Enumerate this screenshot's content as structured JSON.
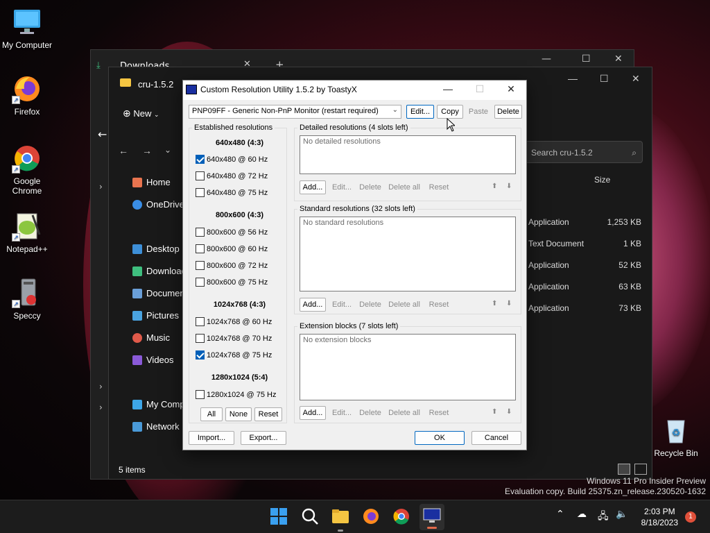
{
  "desktop": {
    "icons": [
      {
        "label": "My Computer"
      },
      {
        "label": "Firefox"
      },
      {
        "label": "Google Chrome"
      },
      {
        "label": "Notepad++"
      },
      {
        "label": "Speccy"
      },
      {
        "label": "Recycle Bin"
      }
    ],
    "watermark_line1": "Windows 11 Pro Insider Preview",
    "watermark_line2": "Evaluation copy. Build 25375.zn_release.230520-1632"
  },
  "explorer_back": {
    "tab_title": "Downloads"
  },
  "explorer": {
    "tab_title": "cru-1.5.2",
    "new_label": "New",
    "search_placeholder": "Search cru-1.5.2",
    "col_size": "Size",
    "nav": [
      "Home",
      "OneDrive",
      "Desktop",
      "Downloads",
      "Documents",
      "Pictures",
      "Music",
      "Videos",
      "My Computer",
      "Network"
    ],
    "rows": [
      {
        "type": "Application",
        "size": "1,253 KB"
      },
      {
        "type": "Text Document",
        "size": "1 KB"
      },
      {
        "type": "Application",
        "size": "52 KB"
      },
      {
        "type": "Application",
        "size": "63 KB"
      },
      {
        "type": "Application",
        "size": "73 KB"
      }
    ],
    "status": "5 items"
  },
  "dialog": {
    "title": "Custom Resolution Utility 1.5.2 by ToastyX",
    "monitor": "PNP09FF - Generic Non-PnP Monitor (restart required)",
    "top_buttons": {
      "edit": "Edit...",
      "copy": "Copy",
      "paste": "Paste",
      "delete": "Delete"
    },
    "established": {
      "title": "Established resolutions",
      "groups": [
        {
          "head": "640x480 (4:3)",
          "items": [
            {
              "label": "640x480 @ 60 Hz",
              "checked": true
            },
            {
              "label": "640x480 @ 72 Hz",
              "checked": false
            },
            {
              "label": "640x480 @ 75 Hz",
              "checked": false
            }
          ]
        },
        {
          "head": "800x600 (4:3)",
          "items": [
            {
              "label": "800x600 @ 56 Hz",
              "checked": false
            },
            {
              "label": "800x600 @ 60 Hz",
              "checked": false
            },
            {
              "label": "800x600 @ 72 Hz",
              "checked": false
            },
            {
              "label": "800x600 @ 75 Hz",
              "checked": false
            }
          ]
        },
        {
          "head": "1024x768 (4:3)",
          "items": [
            {
              "label": "1024x768 @ 60 Hz",
              "checked": false
            },
            {
              "label": "1024x768 @ 70 Hz",
              "checked": false
            },
            {
              "label": "1024x768 @ 75 Hz",
              "checked": true
            }
          ]
        },
        {
          "head": "1280x1024 (5:4)",
          "items": [
            {
              "label": "1280x1024 @ 75 Hz",
              "checked": false
            }
          ]
        }
      ],
      "buttons": {
        "all": "All",
        "none": "None",
        "reset": "Reset"
      }
    },
    "detailed": {
      "title": "Detailed resolutions (4 slots left)",
      "empty": "No detailed resolutions"
    },
    "standard": {
      "title": "Standard resolutions (32 slots left)",
      "empty": "No standard resolutions"
    },
    "extension": {
      "title": "Extension blocks (7 slots left)",
      "empty": "No extension blocks"
    },
    "row_buttons": {
      "add": "Add...",
      "edit": "Edit...",
      "delete": "Delete",
      "delete_all": "Delete all",
      "reset": "Reset",
      "up": "⬆",
      "down": "⬇"
    },
    "import": "Import...",
    "export": "Export...",
    "ok": "OK",
    "cancel": "Cancel"
  },
  "taskbar": {
    "time": "2:03 PM",
    "date": "8/18/2023",
    "notifications": "1"
  },
  "colors": {
    "accent": "#0067c0",
    "checkbox": "#005fb8"
  }
}
